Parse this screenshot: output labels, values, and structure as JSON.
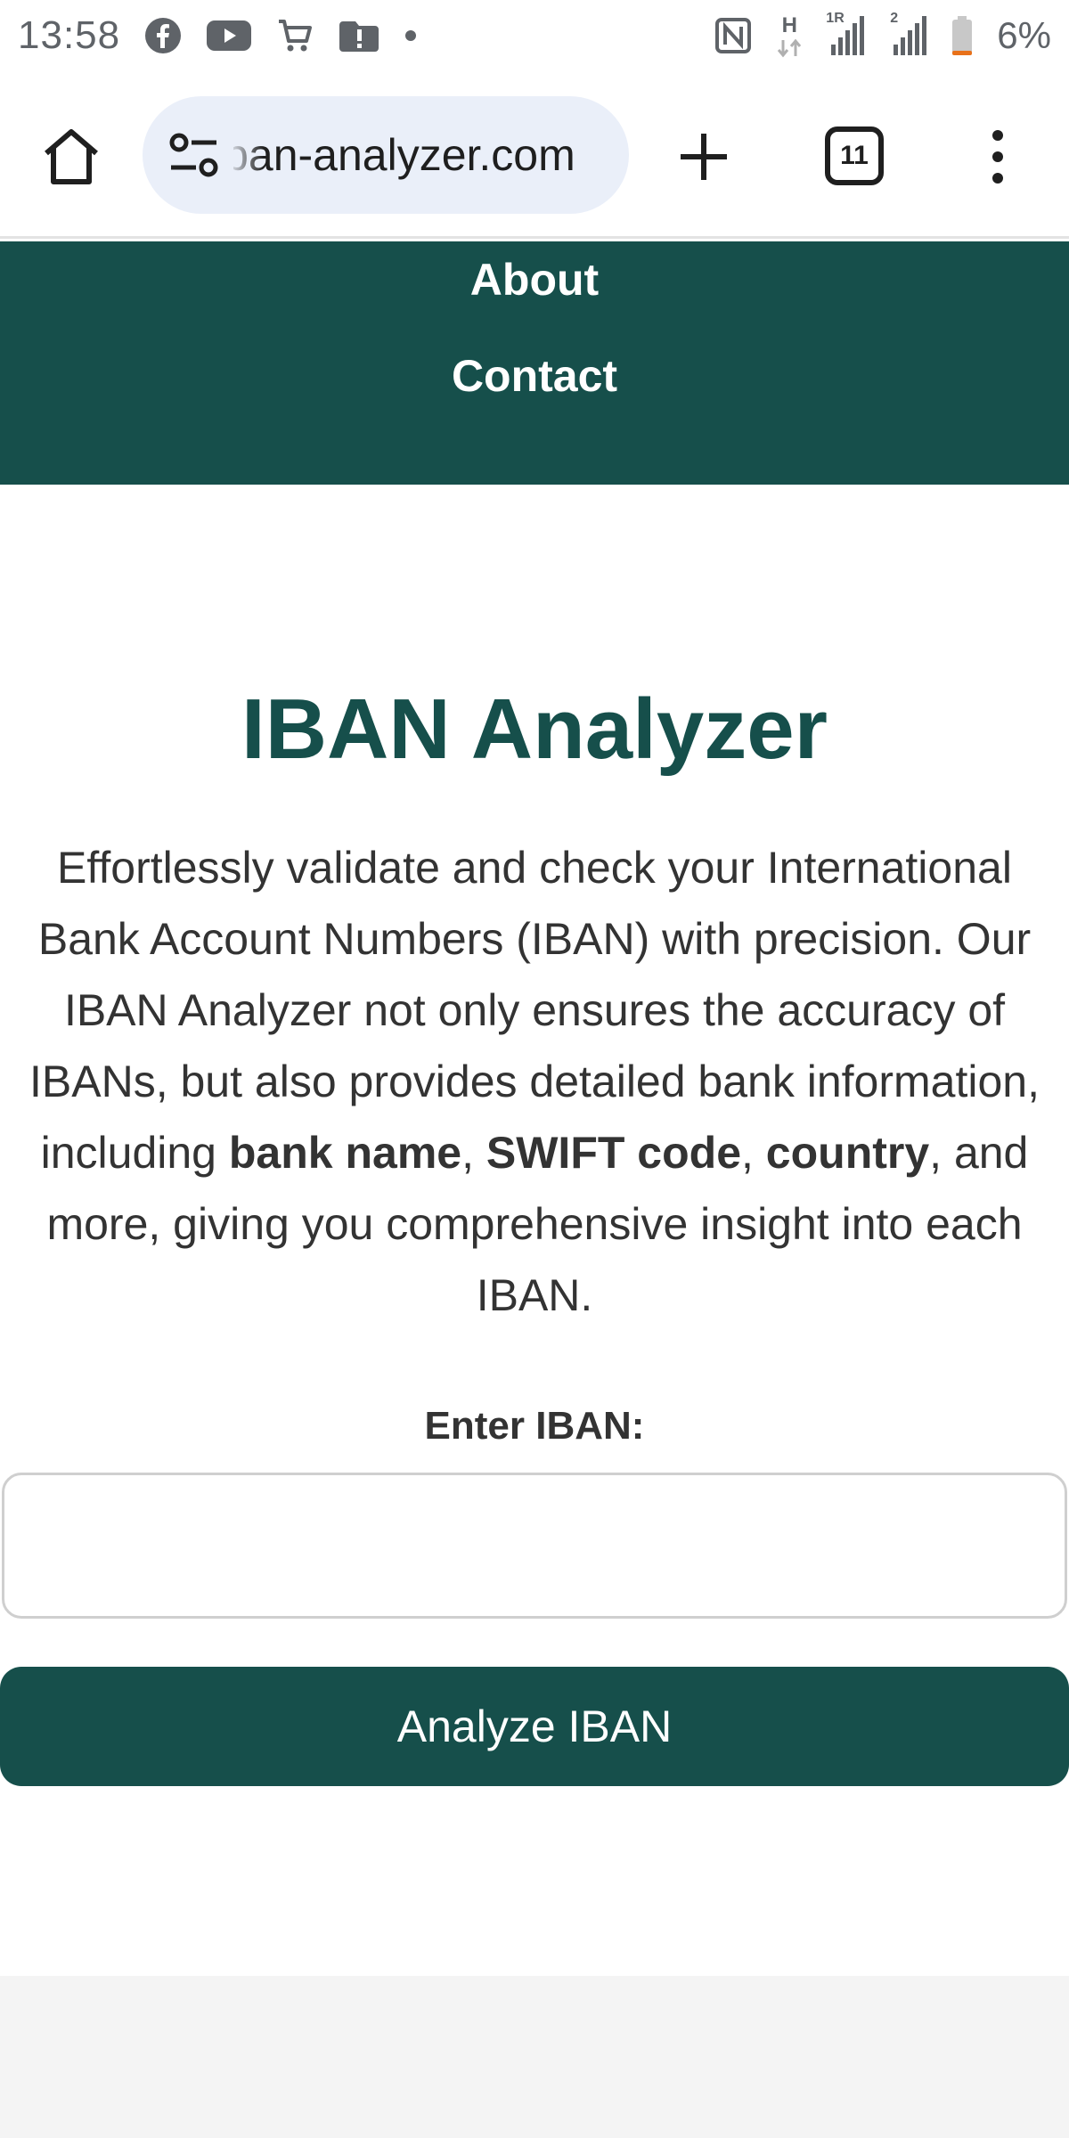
{
  "status_bar": {
    "time": "13:58",
    "notification_icons": [
      "facebook-icon",
      "youtube-icon",
      "shopping-cart-icon",
      "alert-icon",
      "dot-icon"
    ],
    "system_icons": [
      "nfc-icon",
      "data-activity-icon",
      "signal-sim1-icon",
      "signal-sim2-icon",
      "battery-low-icon"
    ],
    "signal_labels": [
      "H",
      "1R",
      "2"
    ],
    "battery": "6%",
    "battery_color": "#e8711a"
  },
  "browser": {
    "url": "iban-analyzer.com",
    "tab_count": "11",
    "icons": [
      "home-icon",
      "site-settings-icon",
      "plus-icon",
      "tabs-icon",
      "more-vert-icon"
    ]
  },
  "nav": {
    "about": "About",
    "contact": "Contact",
    "background": "#164f4b"
  },
  "main": {
    "title": "IBAN Analyzer",
    "intro_parts": {
      "p1": "Effortlessly validate and check your International Bank Account Numbers (IBAN) with precision. Our IBAN Analyzer not only ensures the accuracy of IBANs, but also provides detailed bank information, including ",
      "b1": "bank name",
      "p2": ", ",
      "b2": "SWIFT code",
      "p3": ", ",
      "b3": "country",
      "p4": ", and more, giving you comprehensive insight into each IBAN."
    },
    "field_label": "Enter IBAN:",
    "input_value": "",
    "button_label": "Analyze IBAN",
    "accent_color": "#164f4b"
  }
}
